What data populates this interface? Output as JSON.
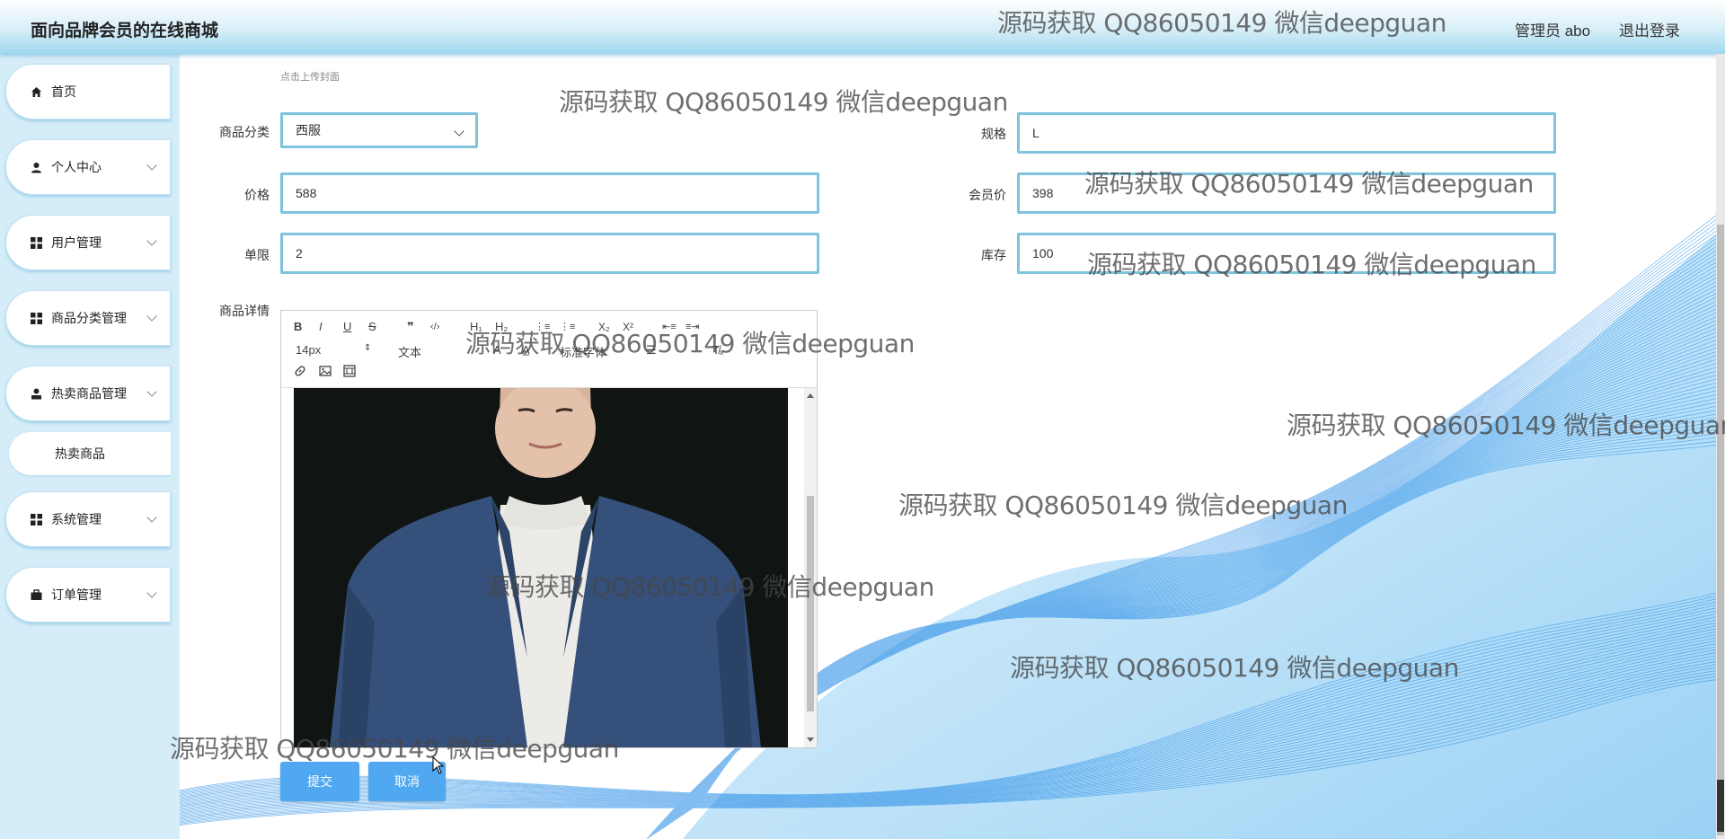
{
  "header": {
    "title": "面向品牌会员的在线商城",
    "admin": "管理员 abo",
    "logout": "退出登录"
  },
  "sidebar": {
    "items": [
      {
        "label": "首页",
        "icon": "home-icon"
      },
      {
        "label": "个人中心",
        "icon": "user-icon"
      },
      {
        "label": "用户管理",
        "icon": "grid-icon"
      },
      {
        "label": "商品分类管理",
        "icon": "grid-icon"
      },
      {
        "label": "热卖商品管理",
        "icon": "person-icon"
      },
      {
        "label": "系统管理",
        "icon": "grid-icon"
      },
      {
        "label": "订单管理",
        "icon": "briefcase-icon"
      }
    ],
    "submenu": {
      "label": "热卖商品"
    }
  },
  "form": {
    "cover_hint": "点击上传封面",
    "category_label": "商品分类",
    "category_value": "西服",
    "spec_label": "规格",
    "spec_value": "L",
    "price_label": "价格",
    "price_value": "588",
    "member_price_label": "会员价",
    "member_price_value": "398",
    "limit_label": "单限",
    "limit_value": "2",
    "stock_label": "库存",
    "stock_value": "100",
    "detail_label": "商品详情"
  },
  "editor": {
    "toolbar": {
      "bold": "B",
      "italic": "I",
      "underline": "U",
      "strike": "S",
      "quote": "❞",
      "code": "‹/›",
      "h1": "H₁",
      "h2": "H₂",
      "ordered_list": "⋮≡",
      "bullet_list": "⋮≡",
      "subscript": "X₂",
      "superscript": "X²",
      "indent_decrease": "⇤≡",
      "indent_increase": "≡⇥",
      "font_size": "14px",
      "header": "文本",
      "font_family": "标准字体",
      "clear_format": "T̸ₓ"
    }
  },
  "actions": {
    "submit": "提交",
    "cancel": "取消"
  },
  "watermark": {
    "text": "源码获取 QQ86050149 微信deepguan"
  },
  "colors": {
    "accent": "#4fa8f0",
    "field_border": "#7ec4dd",
    "sidebar_bg": "#d5edf8",
    "wave": "#1e88e5"
  }
}
